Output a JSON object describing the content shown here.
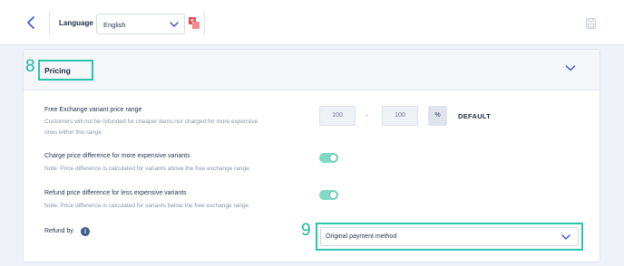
{
  "topbar": {
    "language_label": "Language",
    "language_value": "English",
    "icons": [
      "back-icon",
      "translate-icon",
      "save-icon",
      "chevron-down-icon"
    ]
  },
  "section": {
    "step_number": "8",
    "title": "Pricing"
  },
  "free_exchange": {
    "title": "Free Exchange variant price range",
    "note_line1": "Customers will not be refunded for cheaper items nor charged for more expensive",
    "note_line2": "ones within this range.",
    "min_value": "100",
    "separator": "-",
    "max_value": "100",
    "unit": "%",
    "default_label": "DEFAULT"
  },
  "charge_diff": {
    "title": "Charge price difference for more expensive variants",
    "note": "Note: Price difference is calculated for variants above the free exchange range.",
    "enabled": true
  },
  "refund_diff": {
    "title": "Refund price difference for less expensive variants",
    "note": "Note: Price difference is calculated for variants below the free exchange range.",
    "enabled": true
  },
  "refund_by": {
    "label": "Refund by",
    "info_glyph": "i",
    "step_number": "9",
    "value": "Original payment method"
  },
  "colors": {
    "accent_teal": "#29c4a9",
    "toggle_on": "#82d8c4",
    "link_blue": "#3b5bdb",
    "translate_red": "#e5484d"
  }
}
